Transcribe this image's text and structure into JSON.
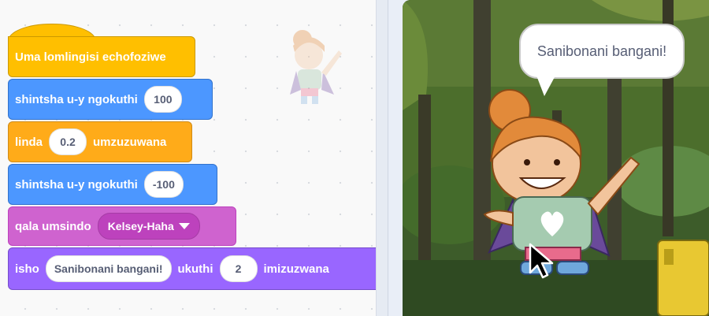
{
  "script": {
    "hat": {
      "label": "Uma lomlingisi echofoziwe"
    },
    "change_y_1": {
      "label": "shintsha u-y ngokuthi",
      "value": "100"
    },
    "wait": {
      "label": "linda",
      "value": "0.2",
      "unit": "umzuzuwana"
    },
    "change_y_2": {
      "label": "shintsha u-y ngokuthi",
      "value": "-100"
    },
    "play_sound": {
      "label": "qala umsindo",
      "sound": "Kelsey-Haha"
    },
    "say_for": {
      "label": "isho",
      "message": "Sanibonani bangani!",
      "for_label": "ukuthi",
      "secs": "2",
      "unit": "imizuzwana"
    }
  },
  "stage": {
    "speech_bubble": "Sanibonani bangani!",
    "cursor_icon": "arrow-cursor-icon"
  },
  "colors": {
    "events": "#ffbf00",
    "motion": "#4c97ff",
    "control": "#ffab19",
    "sound": "#cf63cf",
    "looks": "#9966ff"
  }
}
